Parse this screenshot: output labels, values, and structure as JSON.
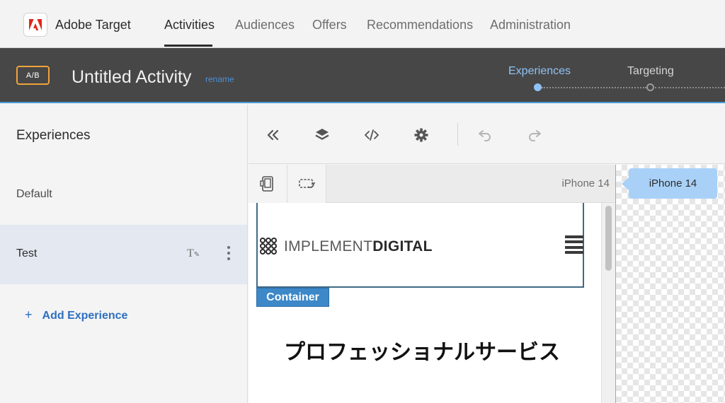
{
  "topnav": {
    "app_name": "Adobe Target",
    "tabs": [
      {
        "label": "Activities",
        "active": true
      },
      {
        "label": "Audiences",
        "active": false
      },
      {
        "label": "Offers",
        "active": false
      },
      {
        "label": "Recommendations",
        "active": false
      },
      {
        "label": "Administration",
        "active": false
      }
    ]
  },
  "activity": {
    "type_badge": "A/B",
    "title": "Untitled Activity",
    "rename_label": "rename",
    "steps": [
      {
        "label": "Experiences",
        "state": "active"
      },
      {
        "label": "Targeting",
        "state": "pending"
      }
    ]
  },
  "sidebar": {
    "title": "Experiences",
    "items": [
      {
        "label": "Default",
        "selected": false
      },
      {
        "label": "Test",
        "selected": true
      }
    ],
    "add_label": "Add Experience",
    "add_icon": "+"
  },
  "toolbar": {
    "icons": [
      "collapse-icon",
      "layers-icon",
      "code-icon",
      "settings-icon",
      "undo-icon",
      "redo-icon"
    ]
  },
  "device_bar": {
    "current_device": "iPhone 14"
  },
  "preview": {
    "logo_light": "IMPLEMENT",
    "logo_bold": "DIGITAL",
    "container_tag": "Container",
    "heading": "プロフェッショナルサービス"
  },
  "right_panel": {
    "device_pill": "iPhone 14"
  },
  "colors": {
    "accent_blue": "#4a9bd4",
    "badge_orange": "#f0a33a",
    "container_blue": "#3c88c8",
    "selected_row": "#e3e8f1",
    "header_dark": "#474747"
  }
}
